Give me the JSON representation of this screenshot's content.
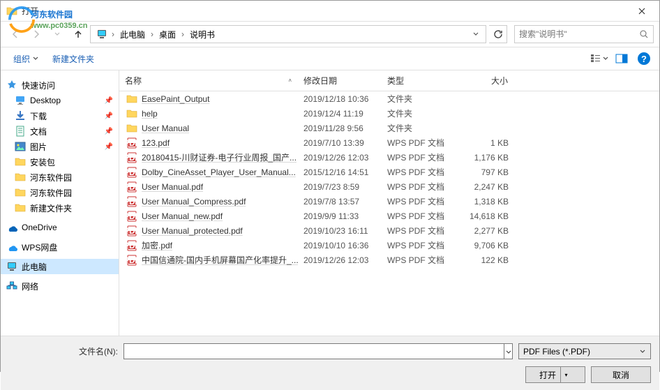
{
  "window": {
    "title": "打开"
  },
  "watermark": {
    "main": "河东软件园",
    "sub": "www.pc0359.cn"
  },
  "nav": {
    "crumbs": [
      "此电脑",
      "桌面",
      "说明书"
    ],
    "search_placeholder": "搜索\"说明书\""
  },
  "toolbar": {
    "organize": "组织",
    "new_folder": "新建文件夹"
  },
  "sidebar": {
    "quick": "快速访问",
    "items": [
      {
        "label": "Desktop",
        "pin": true
      },
      {
        "label": "下载",
        "pin": true
      },
      {
        "label": "文档",
        "pin": true
      },
      {
        "label": "图片",
        "pin": true
      },
      {
        "label": "安装包",
        "pin": false
      },
      {
        "label": "河东软件园",
        "pin": false
      },
      {
        "label": "河东软件园",
        "pin": false
      },
      {
        "label": "新建文件夹",
        "pin": false
      }
    ],
    "onedrive": "OneDrive",
    "wps": "WPS网盘",
    "thispc": "此电脑",
    "network": "网络"
  },
  "columns": {
    "name": "名称",
    "date": "修改日期",
    "type": "类型",
    "size": "大小"
  },
  "files": [
    {
      "icon": "folder",
      "name": "EasePaint_Output",
      "date": "2019/12/18 10:36",
      "type": "文件夹",
      "size": ""
    },
    {
      "icon": "folder",
      "name": "help",
      "date": "2019/12/4 11:19",
      "type": "文件夹",
      "size": ""
    },
    {
      "icon": "folder",
      "name": "User Manual",
      "date": "2019/11/28 9:56",
      "type": "文件夹",
      "size": ""
    },
    {
      "icon": "pdf",
      "name": "123.pdf",
      "date": "2019/7/10 13:39",
      "type": "WPS PDF 文档",
      "size": "1 KB"
    },
    {
      "icon": "pdf",
      "name": "20180415-川财证券-电子行业周报_国产...",
      "date": "2019/12/26 12:03",
      "type": "WPS PDF 文档",
      "size": "1,176 KB"
    },
    {
      "icon": "pdf",
      "name": "Dolby_CineAsset_Player_User_Manual...",
      "date": "2015/12/16 14:51",
      "type": "WPS PDF 文档",
      "size": "797 KB"
    },
    {
      "icon": "pdf",
      "name": "User Manual.pdf",
      "date": "2019/7/23 8:59",
      "type": "WPS PDF 文档",
      "size": "2,247 KB"
    },
    {
      "icon": "pdf",
      "name": "User Manual_Compress.pdf",
      "date": "2019/7/8 13:57",
      "type": "WPS PDF 文档",
      "size": "1,318 KB"
    },
    {
      "icon": "pdf",
      "name": "User Manual_new.pdf",
      "date": "2019/9/9 11:33",
      "type": "WPS PDF 文档",
      "size": "14,618 KB"
    },
    {
      "icon": "pdf",
      "name": "User Manual_protected.pdf",
      "date": "2019/10/23 16:11",
      "type": "WPS PDF 文档",
      "size": "2,277 KB"
    },
    {
      "icon": "pdf",
      "name": "加密.pdf",
      "date": "2019/10/10 16:36",
      "type": "WPS PDF 文档",
      "size": "9,706 KB"
    },
    {
      "icon": "pdf",
      "name": "中国信通院-国内手机屏幕国产化率提升_...",
      "date": "2019/12/26 12:03",
      "type": "WPS PDF 文档",
      "size": "122 KB"
    }
  ],
  "bottom": {
    "filename_label": "文件名(N):",
    "filter": "PDF Files (*.PDF)",
    "open": "打开",
    "cancel": "取消"
  }
}
